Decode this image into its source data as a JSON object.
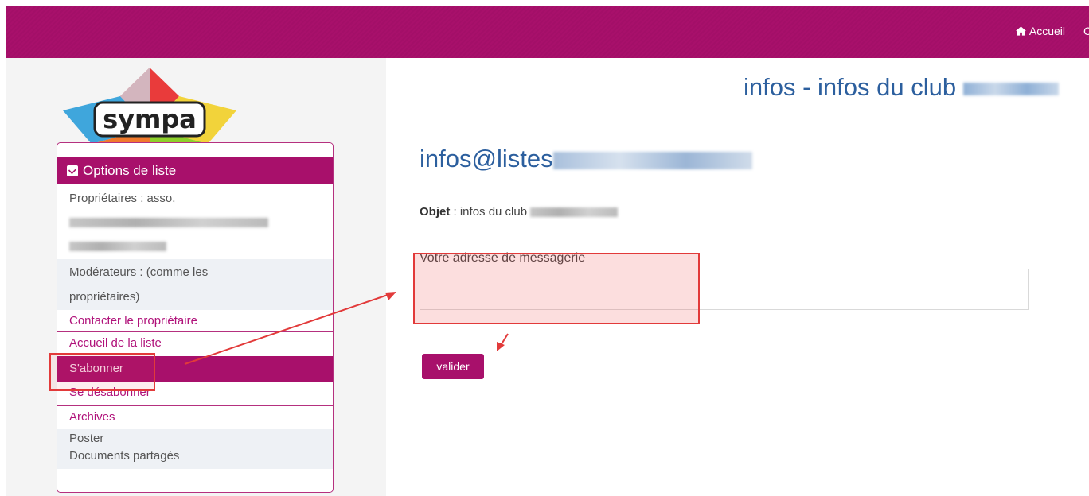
{
  "topbar": {
    "home_label": "Accueil",
    "home_icon": "home-icon",
    "brand_color": "#a8106b"
  },
  "logo": {
    "text": "sympa"
  },
  "sidebar": {
    "header": "Options de liste",
    "header_icon": "envelope-icon",
    "owners_label": "Propriétaires : asso,",
    "moderators_line1": "Modérateurs : (comme les",
    "moderators_line2": "propriétaires)",
    "items": [
      {
        "label": "Contacter le propriétaire"
      },
      {
        "label": "Accueil de la liste"
      },
      {
        "label": "S'abonner"
      },
      {
        "label": "Se désabonner"
      },
      {
        "label": "Archives"
      },
      {
        "label": "Poster"
      },
      {
        "label": "Documents partagés"
      }
    ]
  },
  "main": {
    "page_title": "infos - infos du club",
    "list_address": "infos@listes",
    "subject_label": "Objet",
    "subject_value": ": infos du club",
    "email_label": "Votre adresse de messagerie",
    "submit_label": "valider"
  },
  "annotation": {
    "color": "#e23a3a"
  }
}
